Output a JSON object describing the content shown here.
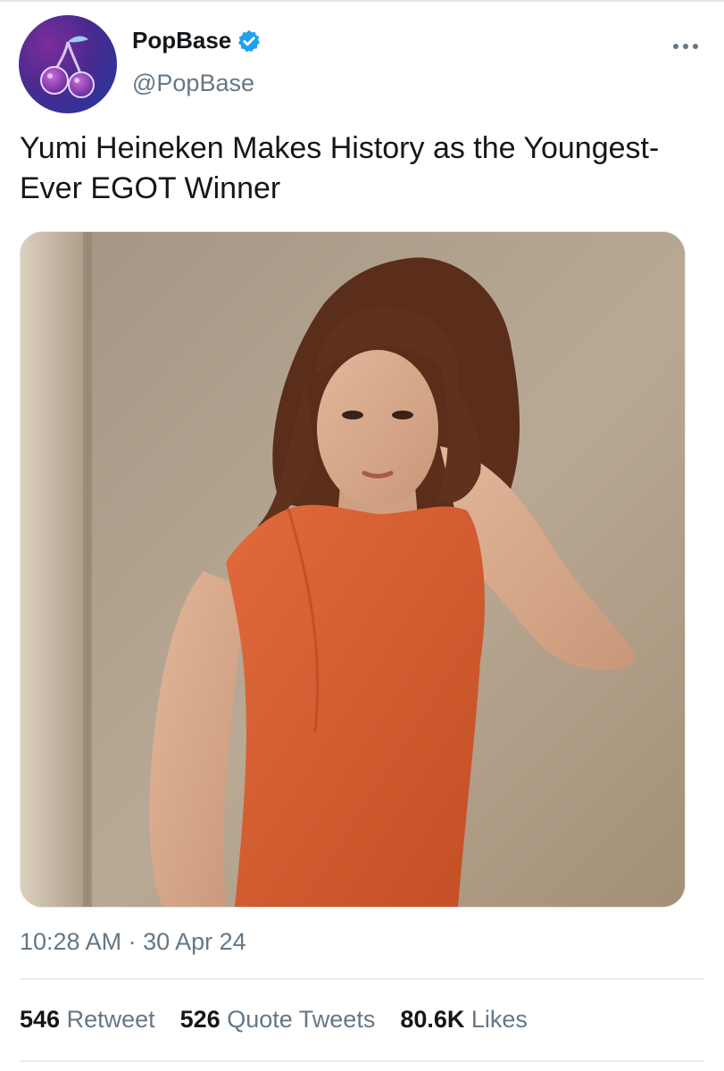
{
  "tweet": {
    "author": {
      "display_name": "PopBase",
      "handle": "@PopBase",
      "verified": true,
      "avatar_icon": "cherry-icon"
    },
    "text": "Yumi Heineken Makes History as the Youngest-Ever EGOT Winner",
    "media": {
      "kind": "photo"
    },
    "timestamp": "10:28 AM · 30 Apr 24",
    "stats": {
      "retweets_count": "546",
      "retweets_label": "Retweet",
      "quotes_count": "526",
      "quotes_label": "Quote Tweets",
      "likes_count": "80.6K",
      "likes_label": "Likes"
    }
  },
  "colors": {
    "verified_blue": "#1da1f2",
    "secondary_text": "#657786",
    "primary_text": "#14171a"
  }
}
